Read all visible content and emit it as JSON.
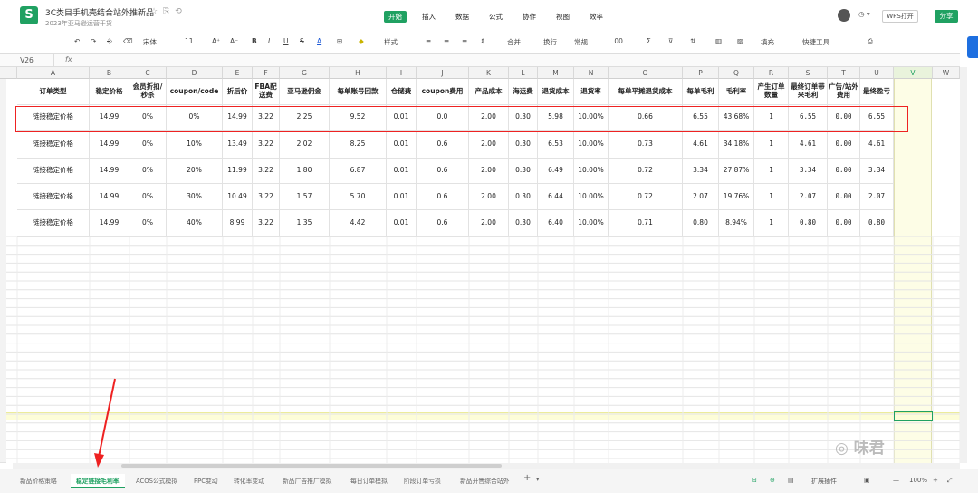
{
  "app": {
    "doc_title": "3C类目手机壳结合站外推新品",
    "doc_subtitle": "2023年亚马逊运营干货",
    "logo": "S",
    "tabs": [
      "开始",
      "插入",
      "数据",
      "公式",
      "协作",
      "视图",
      "效率"
    ],
    "active_tab": "开始",
    "wps_open": "WPS打开",
    "share": "分享"
  },
  "toolbar": {
    "font": "宋体",
    "size": "11",
    "style": "样式",
    "merge": "合并",
    "wrap": "换行",
    "format": "常规",
    "sum": "Σ",
    "fill": "填充",
    "quick_tools": "快捷工具"
  },
  "formula_bar": {
    "cell_ref": "V26",
    "fx": "fx",
    "value": ""
  },
  "sheet": {
    "columns": [
      "A",
      "B",
      "C",
      "D",
      "E",
      "F",
      "G",
      "H",
      "I",
      "J",
      "K",
      "L",
      "M",
      "N",
      "O",
      "P",
      "Q",
      "R",
      "S",
      "T",
      "U",
      "V",
      "W"
    ],
    "headers": [
      "订单类型",
      "稳定价格",
      "会员折扣/秒杀",
      "coupon/code",
      "折后价",
      "FBA配送费",
      "亚马逊佣金",
      "每单账号回款",
      "仓储费",
      "coupon费用",
      "产品成本",
      "海运费",
      "退货成本",
      "退货率",
      "每单平摊退货成本",
      "每单毛利",
      "毛利率",
      "产生订单数量",
      "最终订单带来毛利",
      "广告/站外费用",
      "最终盈亏"
    ],
    "rows": [
      [
        "链接稳定价格",
        "14.99",
        "0%",
        "0%",
        "14.99",
        "3.22",
        "2.25",
        "9.52",
        "0.01",
        "0.0",
        "2.00",
        "0.30",
        "5.98",
        "10.00%",
        "0.66",
        "6.55",
        "43.68%",
        "1",
        "6.55",
        "0.00",
        "6.55"
      ],
      [
        "链接稳定价格",
        "14.99",
        "0%",
        "10%",
        "13.49",
        "3.22",
        "2.02",
        "8.25",
        "0.01",
        "0.6",
        "2.00",
        "0.30",
        "6.53",
        "10.00%",
        "0.73",
        "4.61",
        "34.18%",
        "1",
        "4.61",
        "0.00",
        "4.61"
      ],
      [
        "链接稳定价格",
        "14.99",
        "0%",
        "20%",
        "11.99",
        "3.22",
        "1.80",
        "6.87",
        "0.01",
        "0.6",
        "2.00",
        "0.30",
        "6.49",
        "10.00%",
        "0.72",
        "3.34",
        "27.87%",
        "1",
        "3.34",
        "0.00",
        "3.34"
      ],
      [
        "链接稳定价格",
        "14.99",
        "0%",
        "30%",
        "10.49",
        "3.22",
        "1.57",
        "5.70",
        "0.01",
        "0.6",
        "2.00",
        "0.30",
        "6.44",
        "10.00%",
        "0.72",
        "2.07",
        "19.76%",
        "1",
        "2.07",
        "0.00",
        "2.07"
      ],
      [
        "链接稳定价格",
        "14.99",
        "0%",
        "40%",
        "8.99",
        "3.22",
        "1.35",
        "4.42",
        "0.01",
        "0.6",
        "2.00",
        "0.30",
        "6.40",
        "10.00%",
        "0.71",
        "0.80",
        "8.94%",
        "1",
        "0.80",
        "0.00",
        "0.80"
      ]
    ]
  },
  "sheet_tabs": [
    "新品价格策略",
    "稳定链接毛利率",
    "ACOS公式模拟",
    "PPC变动",
    "转化率变动",
    "新品广告推广模拟",
    "每日订单模拟",
    "阶段订单亏损",
    "新品开售综合站外"
  ],
  "active_sheet": "稳定链接毛利率",
  "status": {
    "plugins": "扩展插件",
    "zoom": "100%"
  },
  "watermark": "味君",
  "colors": {
    "accent": "#20a162",
    "highlight": "#ee2222"
  }
}
